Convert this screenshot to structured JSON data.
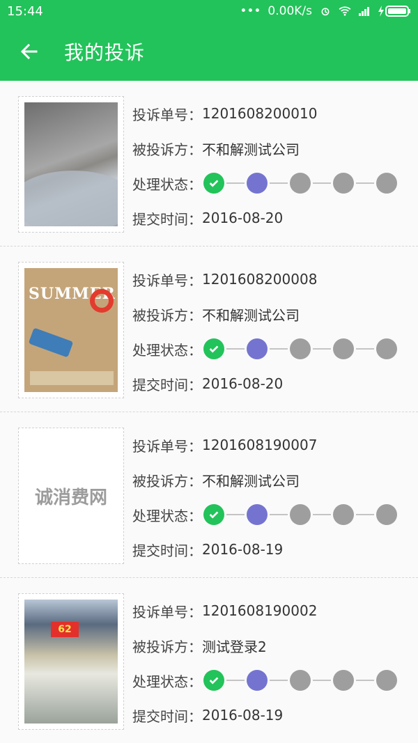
{
  "status": {
    "time": "15:44",
    "speed": "0.00K/s",
    "bg": "#22c35a"
  },
  "appbar": {
    "title": "我的投诉",
    "back_icon": "arrow-left-icon"
  },
  "labels": {
    "order_no": "投诉单号：",
    "target": "被投诉方：",
    "status": "处理状态：",
    "time": "提交时间："
  },
  "complaints": [
    {
      "order_no": "1201608200010",
      "target": "不和解测试公司",
      "time": "2016-08-20",
      "thumb": "photo-indoor",
      "steps_done": 1,
      "steps_total": 5
    },
    {
      "order_no": "1201608200008",
      "target": "不和解测试公司",
      "time": "2016-08-20",
      "thumb": "summer-poster",
      "thumb_text": "SUMMER",
      "steps_done": 1,
      "steps_total": 5
    },
    {
      "order_no": "1201608190007",
      "target": "不和解测试公司",
      "time": "2016-08-19",
      "thumb": "placeholder-logo",
      "thumb_text": "诚消费网",
      "steps_done": 1,
      "steps_total": 5
    },
    {
      "order_no": "1201608190002",
      "target": "测试登录2",
      "time": "2016-08-19",
      "thumb": "supermarket-photo",
      "thumb_text": "62",
      "steps_done": 1,
      "steps_total": 5
    }
  ],
  "colors": {
    "accent": "#22c35a",
    "active_step": "#7474d0",
    "pending_step": "#9e9e9e"
  }
}
